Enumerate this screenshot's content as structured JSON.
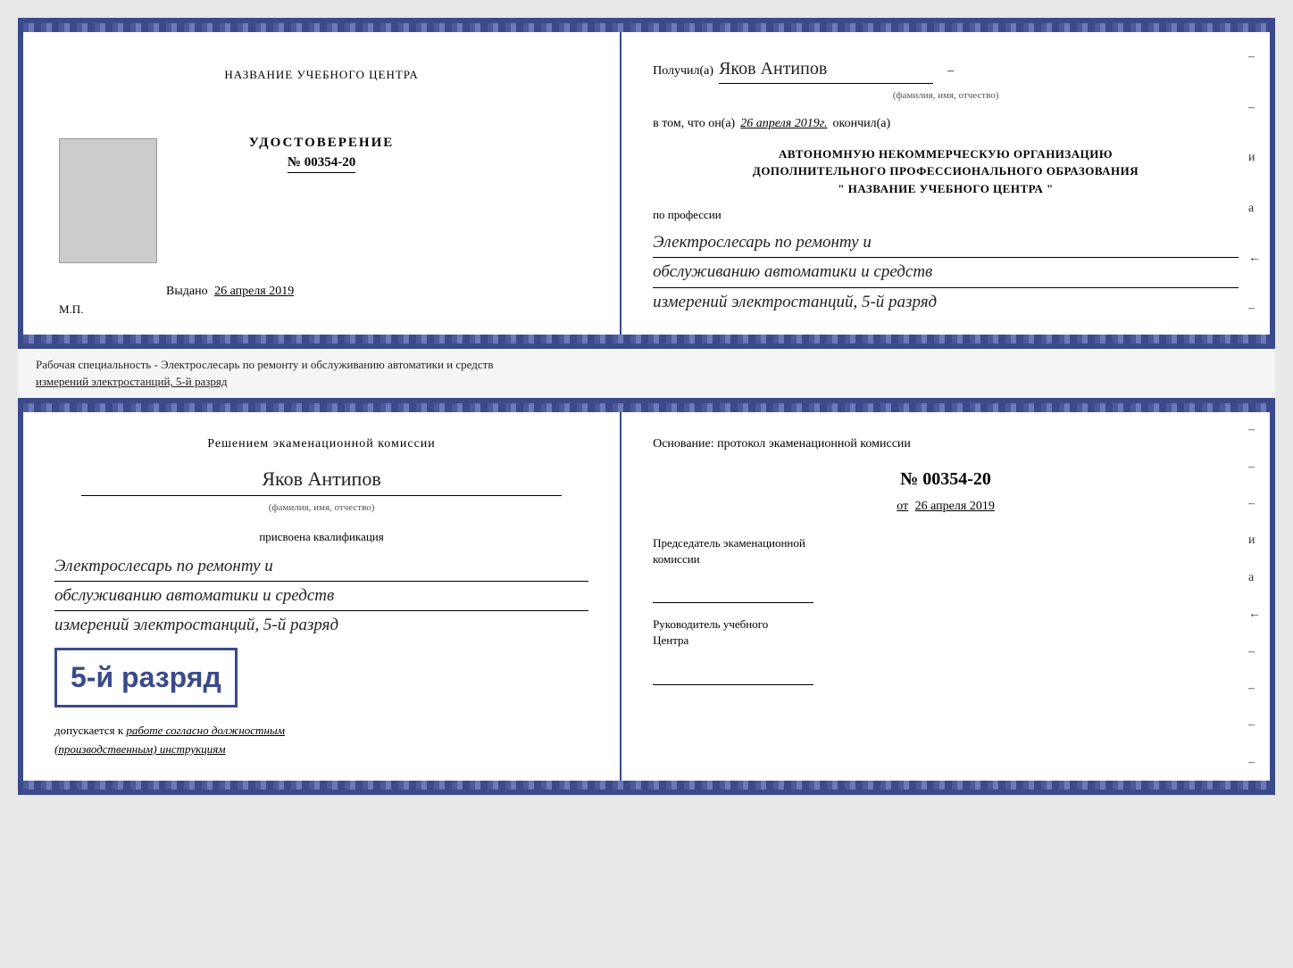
{
  "cert_top": {
    "left": {
      "center_name": "НАЗВАНИЕ УЧЕБНОГО ЦЕНТРА",
      "udostoverenie": "УДОСТОВЕРЕНИЕ",
      "number": "№ 00354-20",
      "vydano_prefix": "Выдано",
      "vydano_date": "26 апреля 2019",
      "mp": "М.П."
    },
    "right": {
      "poluchil_prefix": "Получил(а)",
      "recipient_name": "Яков Антипов",
      "fio_label": "(фамилия, имя, отчество)",
      "vtom_prefix": "в том, что он(а)",
      "vtom_date": "26 апреля 2019г.",
      "okonchil": "окончил(а)",
      "org_line1": "АВТОНОМНУЮ НЕКОММЕРЧЕСКУЮ ОРГАНИЗАЦИЮ",
      "org_line2": "ДОПОЛНИТЕЛЬНОГО ПРОФЕССИОНАЛЬНОГО ОБРАЗОВАНИЯ",
      "org_quote_open": "\"",
      "org_name": "НАЗВАНИЕ УЧЕБНОГО ЦЕНТРА",
      "org_quote_close": "\"",
      "po_professii": "по профессии",
      "profession_line1": "Электрослесарь по ремонту и",
      "profession_line2": "обслуживанию автоматики и средств",
      "profession_line3": "измерений электростанций, 5-й разряд",
      "side_chars": [
        "–",
        "–",
        "и",
        "а",
        "←",
        "–"
      ]
    }
  },
  "middle_text": {
    "line1": "Рабочая специальность - Электрослесарь по ремонту и обслуживанию автоматики и средств",
    "line2": "измерений электростанций, 5-й разряд"
  },
  "cert_bottom": {
    "left": {
      "decision_title": "Решением экаменационной комиссии",
      "person_name": "Яков Антипов",
      "fio_label": "(фамилия, имя, отчество)",
      "prisvoena": "присвоена квалификация",
      "qual_line1": "Электрослесарь по ремонту и",
      "qual_line2": "обслуживанию автоматики и средств",
      "qual_line3": "измерений электростанций, 5-й разряд",
      "razryad_label": "5-й разряд",
      "dopuskaetsya_prefix": "допускается к",
      "dopuskaetsya_text": "работе согласно должностным",
      "dopuskaetsya_text2": "(производственным) инструкциям"
    },
    "right": {
      "osnowanie_prefix": "Основание: протокол экаменационной комиссии",
      "protocol_number": "№ 00354-20",
      "ot_prefix": "от",
      "ot_date": "26 апреля 2019",
      "predsedatel_label": "Председатель экаменационной",
      "predsedatel_label2": "комиссии",
      "rukovoditel_label": "Руководитель учебного",
      "rukovoditel_label2": "Центра",
      "side_chars": [
        "–",
        "–",
        "–",
        "и",
        "а",
        "←",
        "–",
        "–",
        "–",
        "–"
      ]
    }
  }
}
